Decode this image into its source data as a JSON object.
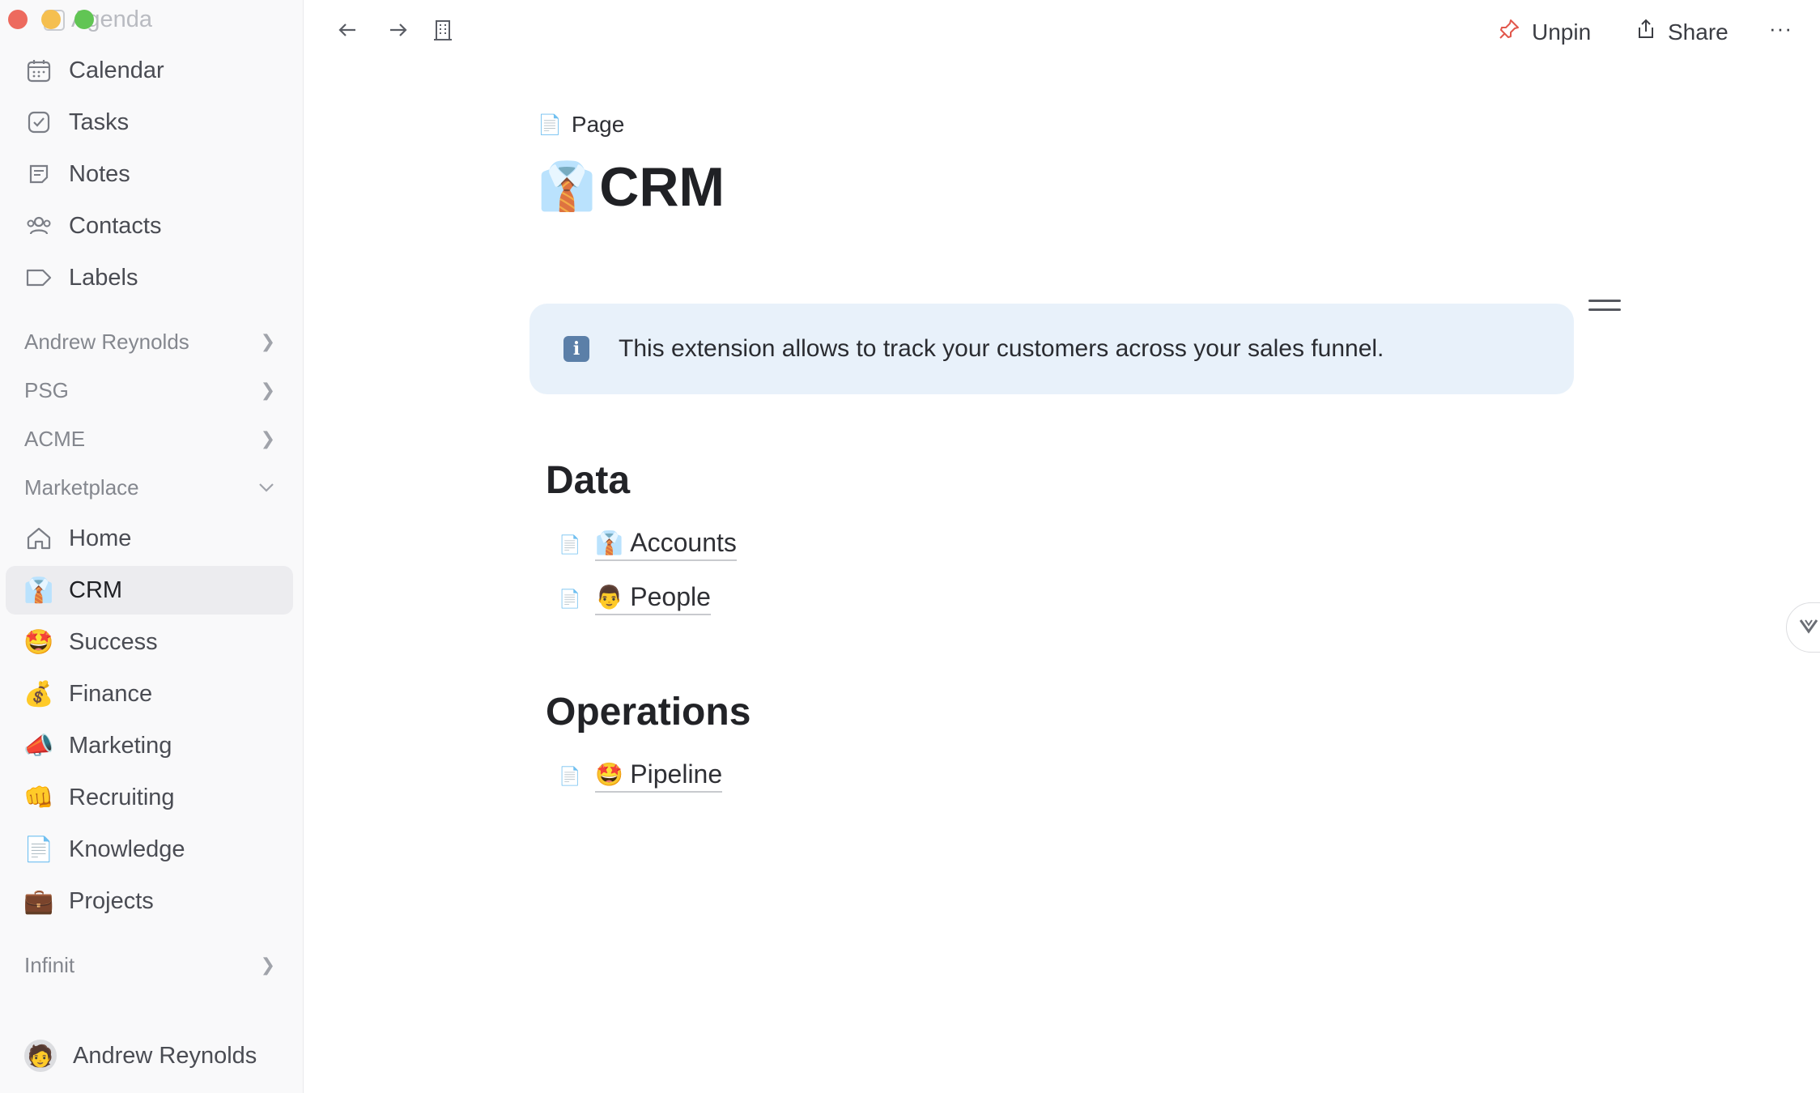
{
  "sidebar": {
    "ghost_item": "Agenda",
    "nav_items": [
      {
        "label": "Calendar",
        "icon": "calendar-icon"
      },
      {
        "label": "Tasks",
        "icon": "checkbox-icon"
      },
      {
        "label": "Notes",
        "icon": "note-icon"
      },
      {
        "label": "Contacts",
        "icon": "contacts-icon"
      },
      {
        "label": "Labels",
        "icon": "label-icon"
      }
    ],
    "sections": [
      "Andrew Reynolds",
      "PSG",
      "ACME",
      "Marketplace"
    ],
    "marketplace_items": [
      {
        "label": "Home",
        "icon": "home-icon"
      },
      {
        "label": "CRM",
        "icon": "necktie-emoji-icon",
        "active": true
      },
      {
        "label": "Success",
        "icon": "star-struck-emoji-icon"
      },
      {
        "label": "Finance",
        "icon": "money-bag-emoji-icon"
      },
      {
        "label": "Marketing",
        "icon": "megaphone-emoji-icon"
      },
      {
        "label": "Recruiting",
        "icon": "fist-emoji-icon"
      },
      {
        "label": "Knowledge",
        "icon": "page-emoji-icon"
      },
      {
        "label": "Projects",
        "icon": "briefcase-emoji-icon"
      }
    ],
    "footer_section": "Infinit",
    "user_name": "Andrew Reynolds"
  },
  "toolbar": {
    "unpin_label": "Unpin",
    "share_label": "Share",
    "more_label": "···"
  },
  "page": {
    "breadcrumb": "Page",
    "title": "CRM",
    "callout_text": "This extension allows to track your customers across your sales funnel.",
    "sections": [
      {
        "heading": "Data",
        "links": [
          {
            "label": "Accounts"
          },
          {
            "label": "People"
          }
        ]
      },
      {
        "heading": "Operations",
        "links": [
          {
            "label": "Pipeline"
          }
        ]
      }
    ]
  },
  "colors": {
    "accent_pin": "#e2574c",
    "callout_bg": "#e8f1fa",
    "active_item_bg": "#ececef"
  }
}
